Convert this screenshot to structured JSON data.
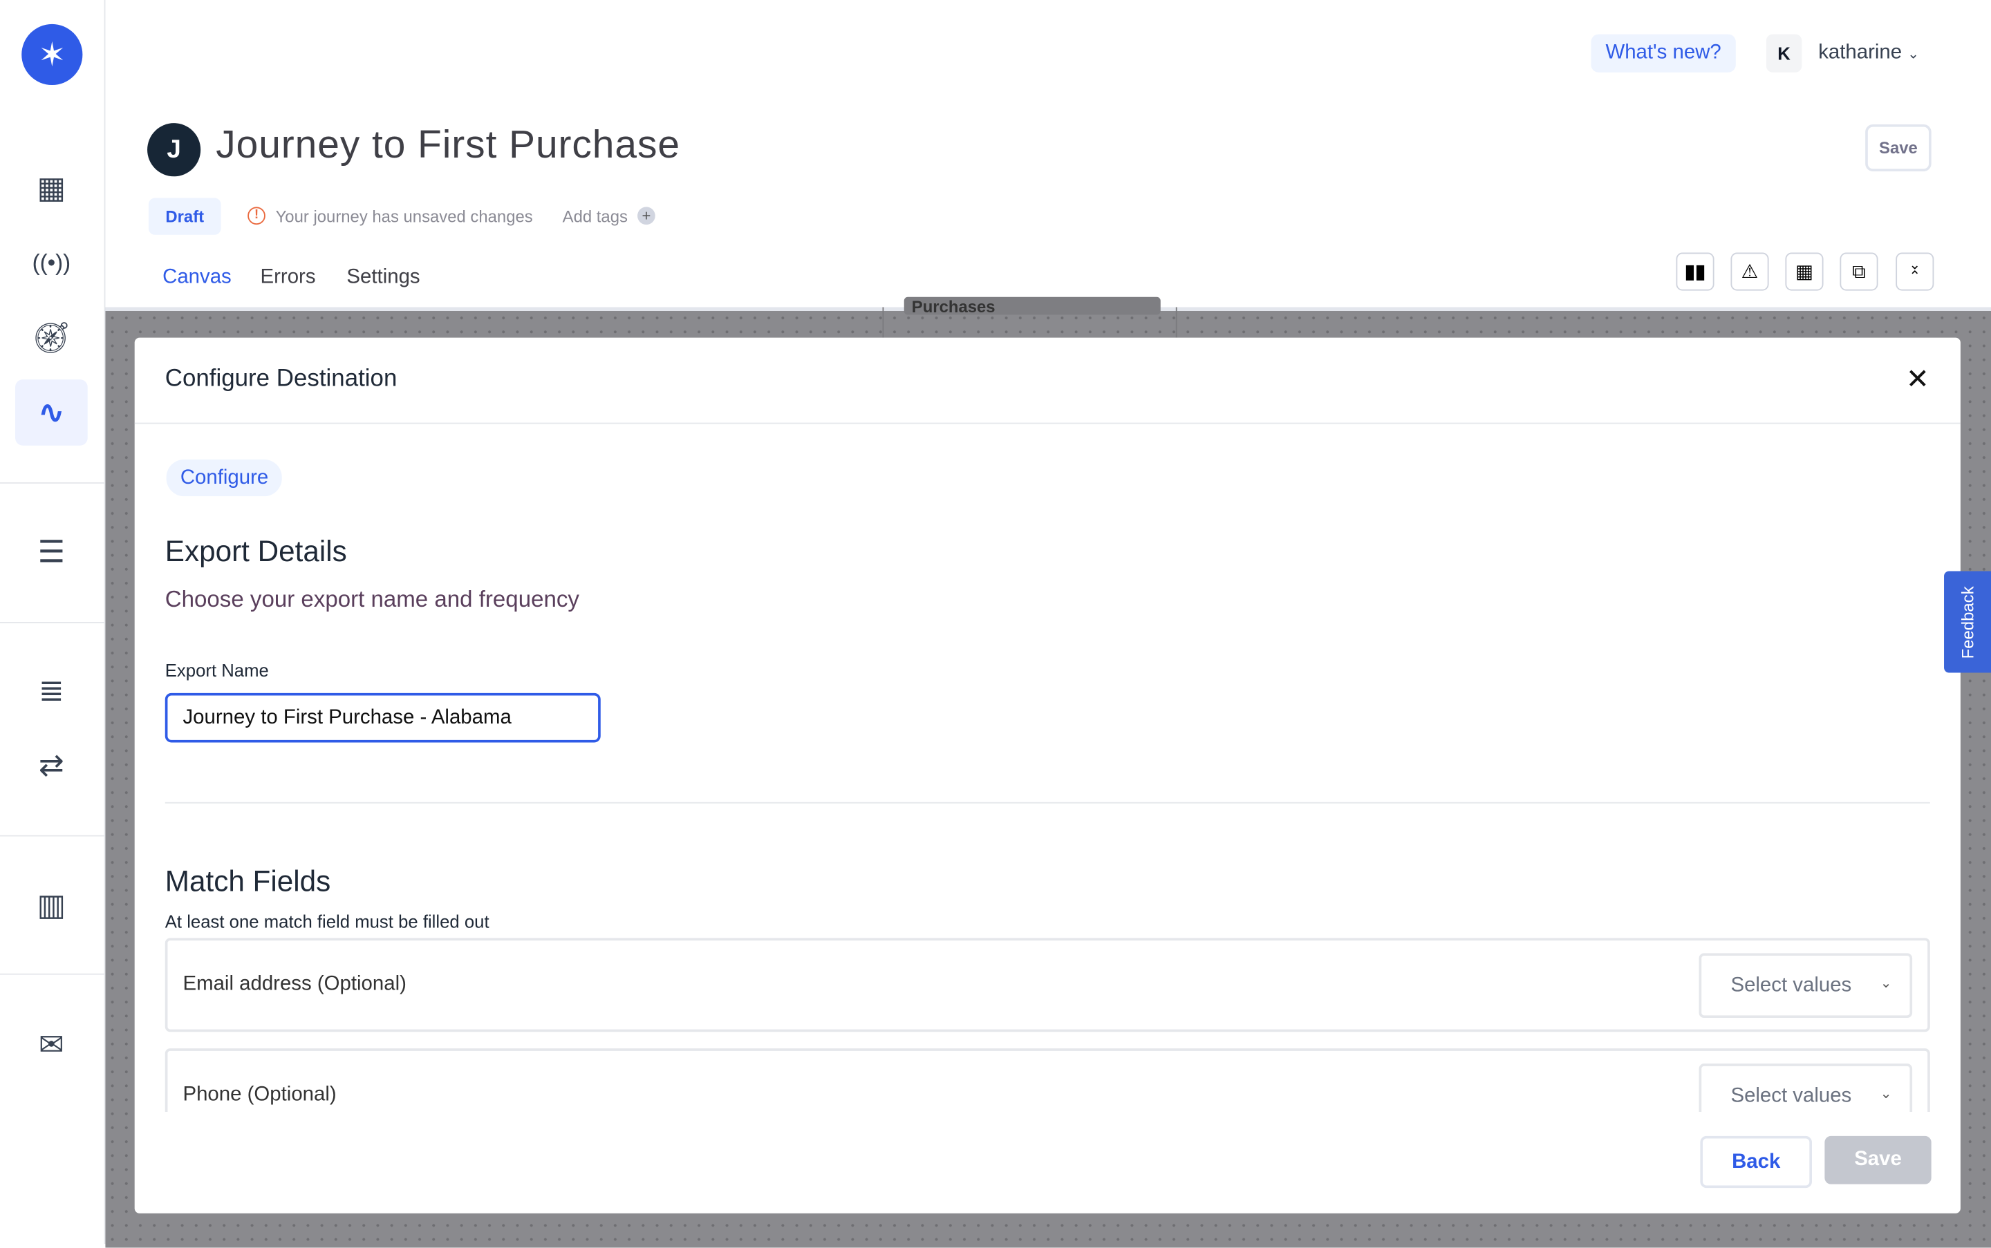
{
  "header": {
    "whats_new": "What's new?",
    "user_initial": "K",
    "user_name": "katharine",
    "journey_initial": "J",
    "title": "Journey to First Purchase",
    "save": "Save",
    "status": "Draft",
    "unsaved": "Your journey has unsaved changes",
    "add_tags": "Add tags",
    "tabs": [
      {
        "label": "Canvas",
        "active": true
      },
      {
        "label": "Errors"
      },
      {
        "label": "Settings"
      }
    ],
    "toolbar_icons": [
      "bar-chart-icon",
      "warning-icon",
      "calendar-icon",
      "add-copy-icon",
      "collapse-icon"
    ]
  },
  "sidebar": {
    "icons": [
      "dashboard-icon",
      "broadcast-icon",
      "compass-icon",
      "journey-icon",
      "list-check-icon",
      "database-icon",
      "sync-icon",
      "building-icon",
      "mail-send-icon"
    ],
    "active": "journey-icon"
  },
  "canvas": {
    "node_label": "Purchases"
  },
  "modal": {
    "title": "Configure Destination",
    "step": "Configure",
    "export_details": {
      "heading": "Export Details",
      "subheading": "Choose your export name and frequency",
      "name_label": "Export Name",
      "name_value": "Journey to First Purchase - Alabama"
    },
    "match_fields": {
      "heading": "Match Fields",
      "note": "At least one match field must be filled out",
      "fields": [
        {
          "label": "Email address (Optional)",
          "placeholder": "Select values"
        },
        {
          "label": "Phone (Optional)",
          "placeholder": "Select values"
        }
      ]
    },
    "back": "Back",
    "save": "Save"
  },
  "feedback": "Feedback",
  "colors": {
    "accent": "#2f5be7",
    "warning": "#ea6a3f",
    "overlay": "#8a8a8e"
  }
}
